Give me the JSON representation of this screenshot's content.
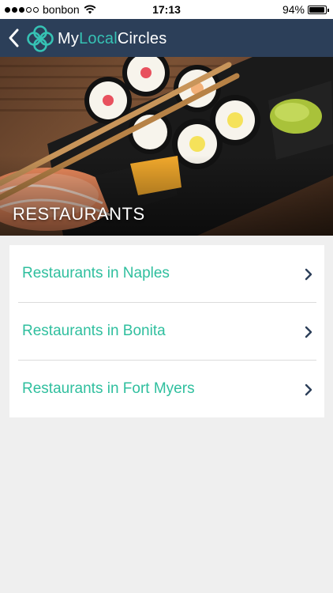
{
  "status_bar": {
    "carrier": "bonbon",
    "time": "17:13",
    "battery": "94%",
    "battery_level": 0.94,
    "signal_bars": 3,
    "signal_total": 5
  },
  "nav": {
    "brand_part1": "My",
    "brand_part2": "Local",
    "brand_part3": "Circles",
    "back_icon": "chevron-left-icon"
  },
  "hero": {
    "title": "RESTAURANTS",
    "image": "sushi-bento-photo"
  },
  "list": {
    "items": [
      {
        "label": "Restaurants in Naples"
      },
      {
        "label": "Restaurants in Bonita"
      },
      {
        "label": "Restaurants in Fort Myers"
      }
    ],
    "chevron_icon": "chevron-right-icon"
  },
  "colors": {
    "nav_background": "#2c3f59",
    "accent": "#36c2b4",
    "link_text": "#2fbf9e",
    "page_background": "#efefef"
  }
}
